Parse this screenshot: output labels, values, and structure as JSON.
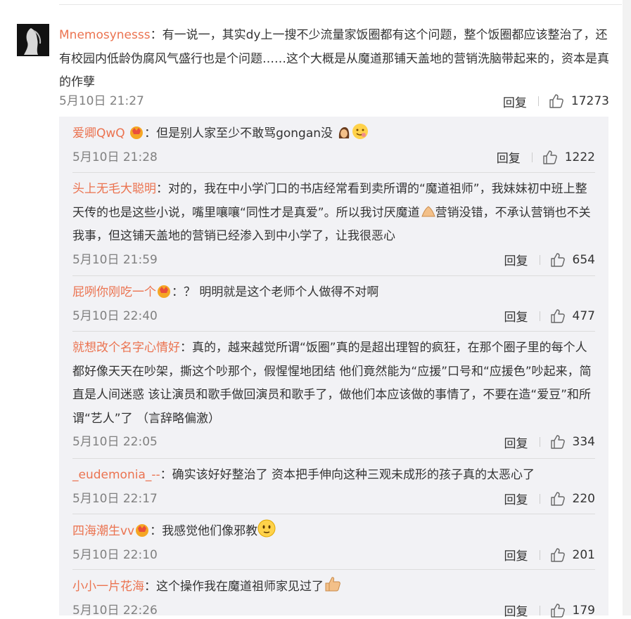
{
  "main_comment": {
    "username": "Mnemosynesss",
    "text": "：有一说一，其实dy上一搜不少流量家饭圈都有这个问题，整个饭圈都应该整治了，还有校园内低龄伪腐风气盛行也是个问题……这个大概是从魔道那铺天盖地的营销洗脑带起来的，资本是真的作孽",
    "time": "5月10日 21:27",
    "reply_label": "回复",
    "likes": "17273"
  },
  "replies": [
    {
      "username": "爱卿QwQ",
      "text": "：但是别人家至少不敢骂gongan没",
      "time": "5月10日 21:28",
      "reply_label": "回复",
      "likes": "1222"
    },
    {
      "username": "头上无毛大聪明",
      "text": "：对的，我在中小学门口的书店经常看到卖所谓的“魔道祖师”，我妹妹初中班上整天传的也是这些小说，嘴里嚷嚷“同性才是真爱”。所以我讨厌魔道",
      "text2": "营销没错，不承认营销也不关我事，但这铺天盖地的营销已经渗入到中小学了，让我很恶心",
      "time": "5月10日 21:59",
      "reply_label": "回复",
      "likes": "654"
    },
    {
      "username": "屁咧你刚吃一个",
      "text": "：？ 明明就是这个老师个人做得不对啊",
      "time": "5月10日 22:40",
      "reply_label": "回复",
      "likes": "477"
    },
    {
      "username": "就想改个名字心情好",
      "text": "：真的，越来越觉所谓“饭圈”真的是超出理智的疯狂，在那个圈子里的每个人都好像天天在吵架，撕这个吵那个，假惺惺地团结 他们竟然能为“应援”口号和“应援色”吵起来，简直是人间迷惑 该让演员和歌手做回演员和歌手了，做他们本应该做的事情了，不要在造“爱豆”和所谓“艺人”了 （言辞略偏激）",
      "time": "5月10日 22:05",
      "reply_label": "回复",
      "likes": "334"
    },
    {
      "username": "_eudemonia_--",
      "text": "：确实该好好整治了 资本把手伸向这种三观未成形的孩子真的太恶心了",
      "time": "5月10日 22:17",
      "reply_label": "回复",
      "likes": "220"
    },
    {
      "username": "四海潮生vv",
      "text": "：我感觉他们像邪教",
      "time": "5月10日 22:10",
      "reply_label": "回复",
      "likes": "201"
    },
    {
      "username": "小小一片花海",
      "text": "：这个操作我在魔道祖师家见过了",
      "time": "5月10日 22:26",
      "reply_label": "回复",
      "likes": "179"
    }
  ],
  "colors": {
    "username": "#eb7350",
    "time": "#808080",
    "reply_bg": "#f2f2f5"
  },
  "icons": [
    "thumbs-up-icon",
    "vip-crown-icon",
    "emoji-icon"
  ]
}
